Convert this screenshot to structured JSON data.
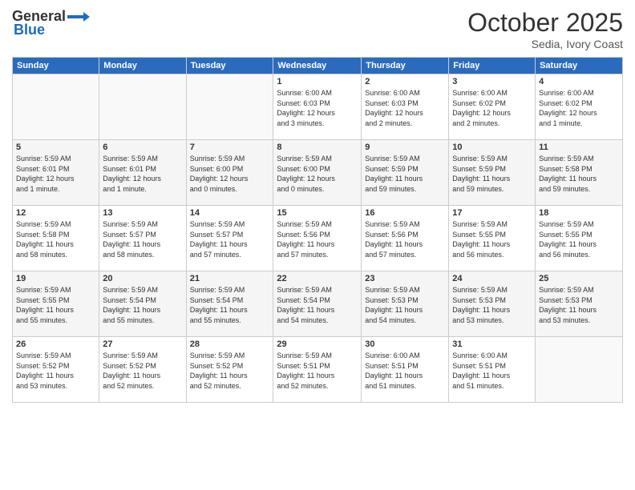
{
  "header": {
    "logo_general": "General",
    "logo_blue": "Blue",
    "month": "October 2025",
    "location": "Sedia, Ivory Coast"
  },
  "weekdays": [
    "Sunday",
    "Monday",
    "Tuesday",
    "Wednesday",
    "Thursday",
    "Friday",
    "Saturday"
  ],
  "weeks": [
    [
      {
        "day": "",
        "info": ""
      },
      {
        "day": "",
        "info": ""
      },
      {
        "day": "",
        "info": ""
      },
      {
        "day": "1",
        "info": "Sunrise: 6:00 AM\nSunset: 6:03 PM\nDaylight: 12 hours\nand 3 minutes."
      },
      {
        "day": "2",
        "info": "Sunrise: 6:00 AM\nSunset: 6:03 PM\nDaylight: 12 hours\nand 2 minutes."
      },
      {
        "day": "3",
        "info": "Sunrise: 6:00 AM\nSunset: 6:02 PM\nDaylight: 12 hours\nand 2 minutes."
      },
      {
        "day": "4",
        "info": "Sunrise: 6:00 AM\nSunset: 6:02 PM\nDaylight: 12 hours\nand 1 minute."
      }
    ],
    [
      {
        "day": "5",
        "info": "Sunrise: 5:59 AM\nSunset: 6:01 PM\nDaylight: 12 hours\nand 1 minute."
      },
      {
        "day": "6",
        "info": "Sunrise: 5:59 AM\nSunset: 6:01 PM\nDaylight: 12 hours\nand 1 minute."
      },
      {
        "day": "7",
        "info": "Sunrise: 5:59 AM\nSunset: 6:00 PM\nDaylight: 12 hours\nand 0 minutes."
      },
      {
        "day": "8",
        "info": "Sunrise: 5:59 AM\nSunset: 6:00 PM\nDaylight: 12 hours\nand 0 minutes."
      },
      {
        "day": "9",
        "info": "Sunrise: 5:59 AM\nSunset: 5:59 PM\nDaylight: 11 hours\nand 59 minutes."
      },
      {
        "day": "10",
        "info": "Sunrise: 5:59 AM\nSunset: 5:59 PM\nDaylight: 11 hours\nand 59 minutes."
      },
      {
        "day": "11",
        "info": "Sunrise: 5:59 AM\nSunset: 5:58 PM\nDaylight: 11 hours\nand 59 minutes."
      }
    ],
    [
      {
        "day": "12",
        "info": "Sunrise: 5:59 AM\nSunset: 5:58 PM\nDaylight: 11 hours\nand 58 minutes."
      },
      {
        "day": "13",
        "info": "Sunrise: 5:59 AM\nSunset: 5:57 PM\nDaylight: 11 hours\nand 58 minutes."
      },
      {
        "day": "14",
        "info": "Sunrise: 5:59 AM\nSunset: 5:57 PM\nDaylight: 11 hours\nand 57 minutes."
      },
      {
        "day": "15",
        "info": "Sunrise: 5:59 AM\nSunset: 5:56 PM\nDaylight: 11 hours\nand 57 minutes."
      },
      {
        "day": "16",
        "info": "Sunrise: 5:59 AM\nSunset: 5:56 PM\nDaylight: 11 hours\nand 57 minutes."
      },
      {
        "day": "17",
        "info": "Sunrise: 5:59 AM\nSunset: 5:55 PM\nDaylight: 11 hours\nand 56 minutes."
      },
      {
        "day": "18",
        "info": "Sunrise: 5:59 AM\nSunset: 5:55 PM\nDaylight: 11 hours\nand 56 minutes."
      }
    ],
    [
      {
        "day": "19",
        "info": "Sunrise: 5:59 AM\nSunset: 5:55 PM\nDaylight: 11 hours\nand 55 minutes."
      },
      {
        "day": "20",
        "info": "Sunrise: 5:59 AM\nSunset: 5:54 PM\nDaylight: 11 hours\nand 55 minutes."
      },
      {
        "day": "21",
        "info": "Sunrise: 5:59 AM\nSunset: 5:54 PM\nDaylight: 11 hours\nand 55 minutes."
      },
      {
        "day": "22",
        "info": "Sunrise: 5:59 AM\nSunset: 5:54 PM\nDaylight: 11 hours\nand 54 minutes."
      },
      {
        "day": "23",
        "info": "Sunrise: 5:59 AM\nSunset: 5:53 PM\nDaylight: 11 hours\nand 54 minutes."
      },
      {
        "day": "24",
        "info": "Sunrise: 5:59 AM\nSunset: 5:53 PM\nDaylight: 11 hours\nand 53 minutes."
      },
      {
        "day": "25",
        "info": "Sunrise: 5:59 AM\nSunset: 5:53 PM\nDaylight: 11 hours\nand 53 minutes."
      }
    ],
    [
      {
        "day": "26",
        "info": "Sunrise: 5:59 AM\nSunset: 5:52 PM\nDaylight: 11 hours\nand 53 minutes."
      },
      {
        "day": "27",
        "info": "Sunrise: 5:59 AM\nSunset: 5:52 PM\nDaylight: 11 hours\nand 52 minutes."
      },
      {
        "day": "28",
        "info": "Sunrise: 5:59 AM\nSunset: 5:52 PM\nDaylight: 11 hours\nand 52 minutes."
      },
      {
        "day": "29",
        "info": "Sunrise: 5:59 AM\nSunset: 5:51 PM\nDaylight: 11 hours\nand 52 minutes."
      },
      {
        "day": "30",
        "info": "Sunrise: 6:00 AM\nSunset: 5:51 PM\nDaylight: 11 hours\nand 51 minutes."
      },
      {
        "day": "31",
        "info": "Sunrise: 6:00 AM\nSunset: 5:51 PM\nDaylight: 11 hours\nand 51 minutes."
      },
      {
        "day": "",
        "info": ""
      }
    ]
  ]
}
